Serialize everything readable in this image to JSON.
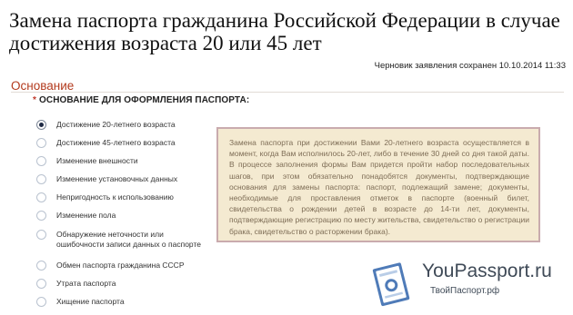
{
  "page": {
    "title": "Замена паспорта гражданина Российской Федерации в случае достижения возраста 20 или 45 лет",
    "draft_status": "Черновик заявления сохранен 10.10.2014 11:33"
  },
  "section": {
    "title": "Основание",
    "field_required_mark": "*",
    "field_label": "ОСНОВАНИЕ ДЛЯ ОФОРМЛЕНИЯ ПАСПОРТА:"
  },
  "options": [
    {
      "label": "Достижение 20-летнего возраста",
      "checked": true
    },
    {
      "label": "Достижение 45-летнего возраста",
      "checked": false
    },
    {
      "label": "Изменение внешности",
      "checked": false
    },
    {
      "label": "Изменение установочных данных",
      "checked": false
    },
    {
      "label": "Непригодность к использованию",
      "checked": false
    },
    {
      "label": "Изменение пола",
      "checked": false
    },
    {
      "label": "Обнаружение неточности или ошибочности записи данных о паспорте",
      "checked": false
    },
    {
      "label": "Обмен паспорта гражданина СССР",
      "checked": false
    },
    {
      "label": "Утрата паспорта",
      "checked": false
    },
    {
      "label": "Хищение паспорта",
      "checked": false
    }
  ],
  "info_box": {
    "text": "Замена паспорта при достижении Вами 20-летнего возраста осуществляется в момент, когда Вам исполнилось 20-лет, либо в течение 30 дней со дня такой даты. В процессе заполнения формы Вам придется пройти набор последовательных шагов, при этом обязательно понадобятся документы, подтверждающие основания для замены паспорта: паспорт, подлежащий замене; документы, необходимые для проставления отметок в паспорте (военный билет, свидетельства о рождении детей в возрасте до 14-ти лет, документы, подтверждающие регистрацию по месту жительства, свидетельство о регистрации брака, свидетельство о расторжении брака)."
  },
  "brand": {
    "name": "YouPassport.ru",
    "subtitle": "ТвойПаспорт.рф",
    "logo_icon": "passport-document-icon",
    "colors": {
      "logo_blue": "#4f7bb8",
      "logo_light": "#b9cde7"
    }
  },
  "colors": {
    "section_title": "#b33a1d",
    "info_bg": "#f4ead1",
    "info_border": "#c9abae",
    "info_text": "#7e6d56"
  }
}
